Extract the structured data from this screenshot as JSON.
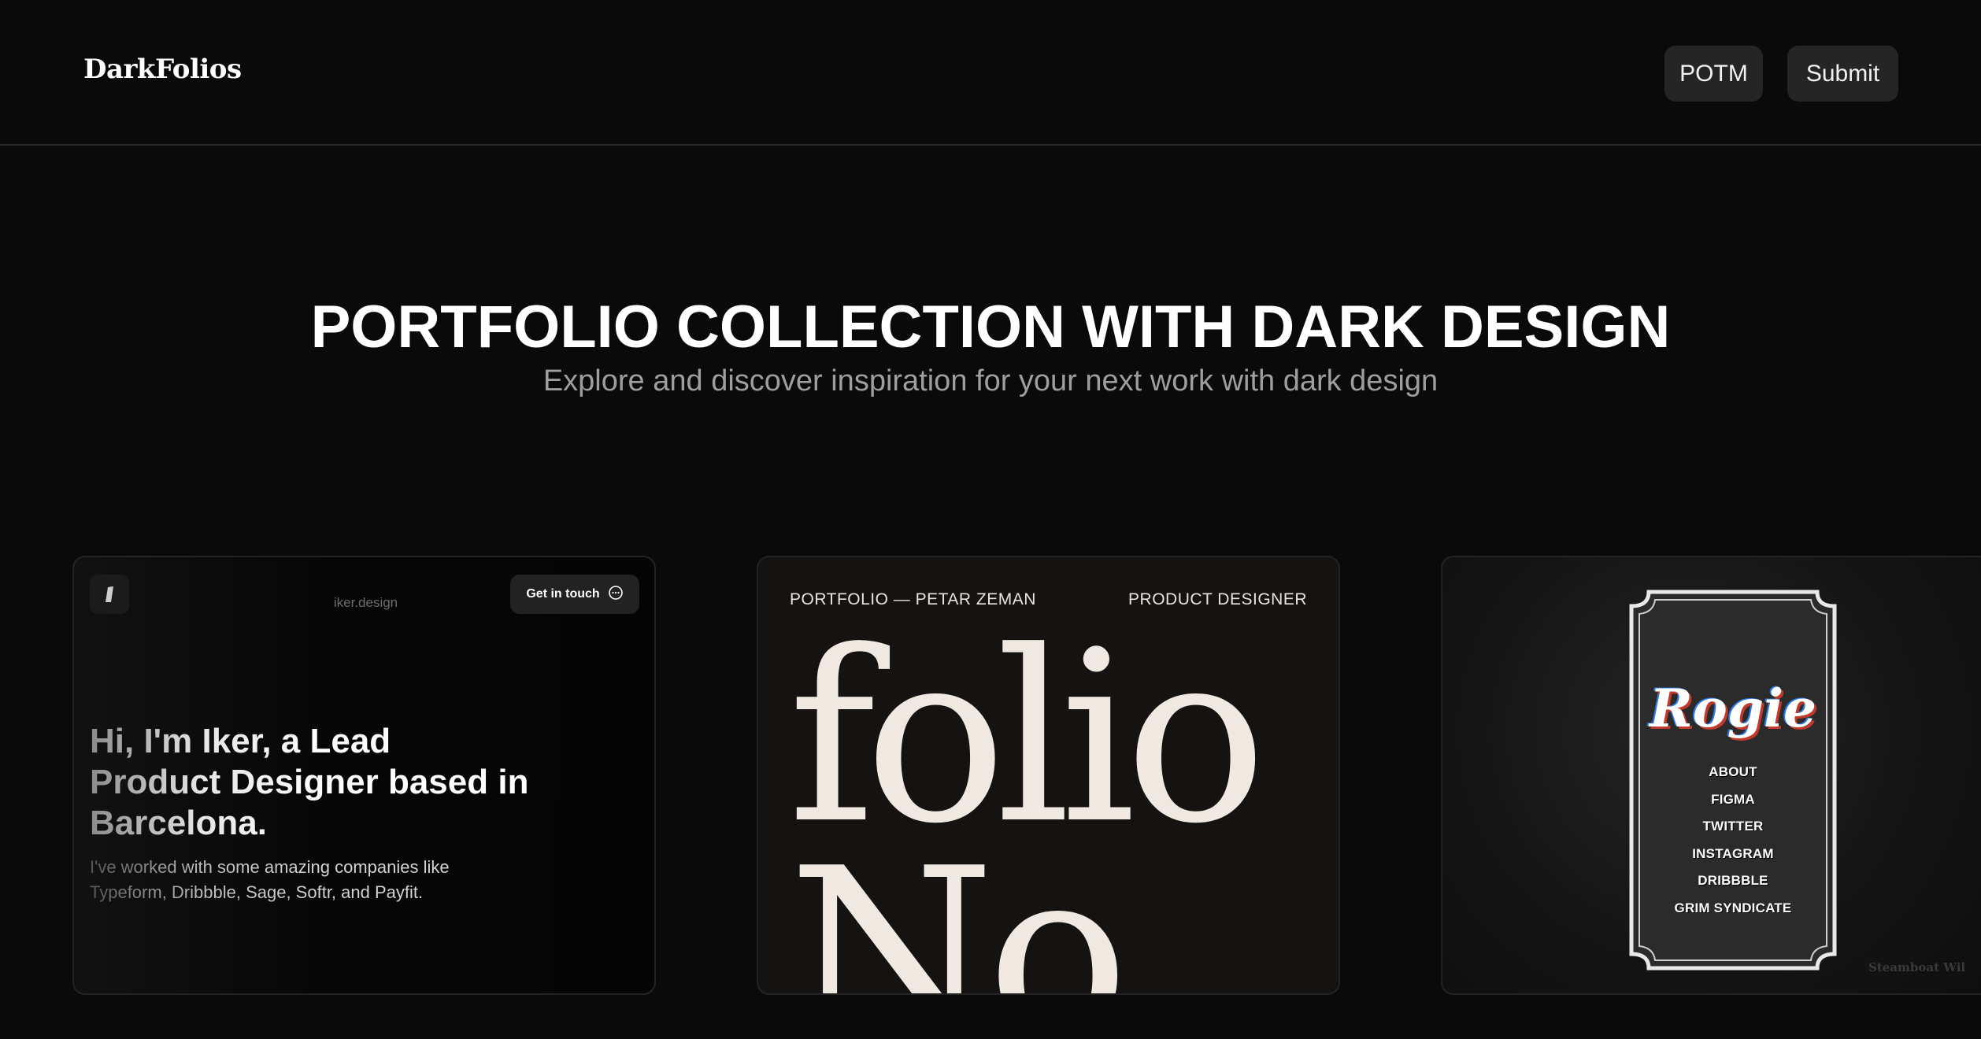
{
  "header": {
    "logo": "DarkFolios",
    "nav": [
      {
        "label": "POTM"
      },
      {
        "label": "Submit"
      }
    ]
  },
  "hero": {
    "title": "PORTFOLIO COLLECTION WITH DARK DESIGN",
    "subtitle": "Explore and discover inspiration for your next work with dark design"
  },
  "cards": [
    {
      "site": "iker.design",
      "cta": "Get in touch",
      "cta_icon": "chat-bubble-icon",
      "logo_icon": "slash-logo-icon",
      "headline": "Hi, I'm Iker, a Lead Product Designer based in Barcelona.",
      "body": "I've worked with some amazing companies like Typeform, Dribbble, Sage, Softr, and Payfit."
    },
    {
      "left_label": "PORTFOLIO — PETAR ZEMAN",
      "right_label": "PRODUCT DESIGNER",
      "big_line_1": "folio",
      "big_line_2": "No"
    },
    {
      "logo": "Rogie",
      "menu": [
        "ABOUT",
        "FIGMA",
        "TWITTER",
        "INSTAGRAM",
        "DRIBBBLE",
        "GRIM SYNDICATE"
      ],
      "caption": "Steamboat Wil"
    }
  ],
  "colors": {
    "background": "#0a0a0a",
    "button_bg": "#252525",
    "subtitle": "#9e9e9e",
    "folio_text": "#efe9e2"
  }
}
